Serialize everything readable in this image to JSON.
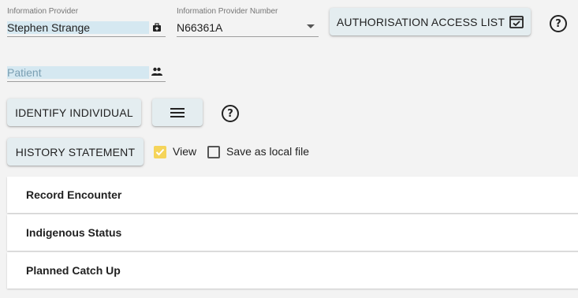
{
  "info_provider": {
    "label": "Information Provider",
    "value": "Stephen Strange",
    "icon": "medical-bag-icon"
  },
  "provider_number": {
    "label": "Information Provider Number",
    "value": "N66361A",
    "icon": "chevron-down-icon"
  },
  "auth_button": {
    "label": "AUTHORISATION ACCESS LIST",
    "icon": "checklist-icon"
  },
  "patient": {
    "placeholder": "Patient",
    "icon": "people-icon"
  },
  "identify_button": {
    "label": "IDENTIFY INDIVIDUAL"
  },
  "menu_button": {
    "icon": "menu-icon"
  },
  "help_icon": "help-circle-icon",
  "history_button": {
    "label": "HISTORY STATEMENT"
  },
  "view_checkbox": {
    "label": "View",
    "checked": true,
    "color": "#f5d45a"
  },
  "save_checkbox": {
    "label": "Save as local file",
    "checked": false
  },
  "panels": [
    {
      "title": "Record Encounter"
    },
    {
      "title": "Indigenous Status"
    },
    {
      "title": "Planned Catch Up"
    }
  ]
}
